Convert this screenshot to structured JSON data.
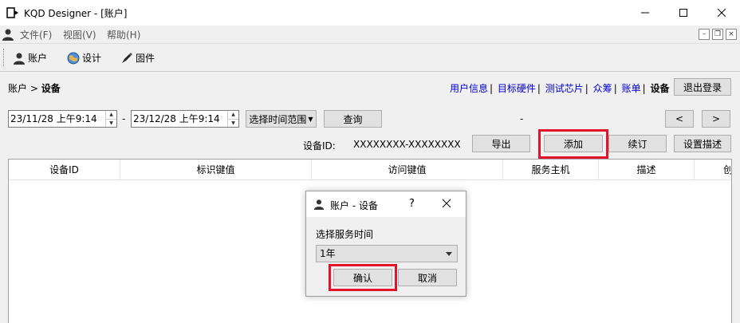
{
  "window": {
    "title": "KQD Designer - [账户]"
  },
  "menu": {
    "items": [
      "文件(F)",
      "视图(V)",
      "帮助(H)"
    ]
  },
  "toolbar": {
    "items": [
      {
        "label": "账户",
        "icon": "user-icon"
      },
      {
        "label": "设计",
        "icon": "globe-icon"
      },
      {
        "label": "固件",
        "icon": "pen-icon"
      }
    ]
  },
  "breadcrumb": {
    "parent": "账户",
    "separator": ">",
    "current": "设备"
  },
  "navlinks": {
    "items": [
      "用户信息",
      "目标硬件",
      "测试芯片",
      "众筹",
      "账单"
    ],
    "separator": "|",
    "current": "设备",
    "logout_label": "退出登录"
  },
  "filter": {
    "start_time": "23/11/28 上午9:14",
    "dash": "-",
    "end_time": "23/12/28 上午9:14",
    "range_label": "选择时间范围",
    "query_label": "查询",
    "center_dash": "-",
    "prev_label": "<",
    "next_label": ">"
  },
  "device": {
    "id_label": "设备ID:",
    "id_value": "XXXXXXXX-XXXXXXXX",
    "export_label": "导出",
    "add_label": "添加",
    "renew_label": "续订",
    "set_desc_label": "设置描述"
  },
  "table": {
    "columns": [
      "设备ID",
      "标识键值",
      "访问键值",
      "服务主机",
      "描述",
      "创"
    ]
  },
  "dialog": {
    "title": "账户 - 设备",
    "help": "?",
    "prompt": "选择服务时间",
    "selected_option": "1年",
    "confirm_label": "确认",
    "cancel_label": "取消"
  },
  "colors": {
    "highlight": "#e0142b",
    "link": "#0000cc"
  }
}
